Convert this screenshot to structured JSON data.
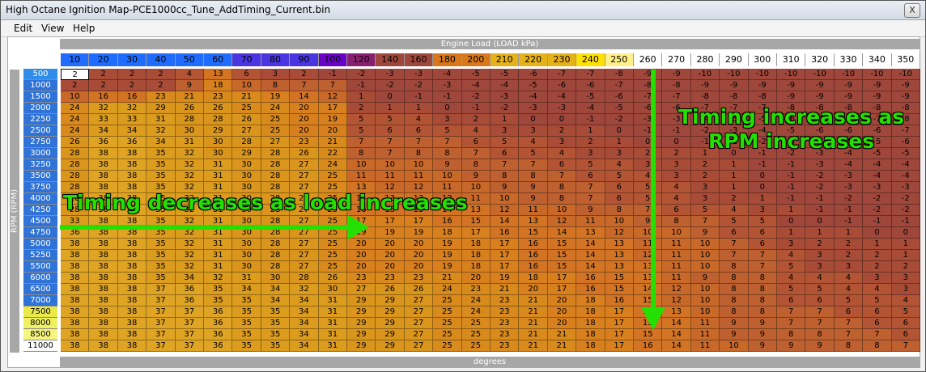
{
  "window": {
    "title": "High Octane Ignition Map-PCE1000cc_Tune_AddTiming_Current.bin",
    "close_label": "X"
  },
  "menu": [
    {
      "label": "Edit"
    },
    {
      "label": "View"
    },
    {
      "label": "Help"
    }
  ],
  "table": {
    "x_axis_title": "Engine Load (LOAD kPa)",
    "y_axis_title": "RPM (RPM)",
    "unit_label": "degrees",
    "load_headers": [
      10,
      20,
      30,
      40,
      50,
      60,
      70,
      80,
      90,
      100,
      120,
      140,
      160,
      180,
      200,
      210,
      220,
      230,
      240,
      250,
      260,
      270,
      280,
      290,
      300,
      310,
      320,
      330,
      340,
      350
    ],
    "rpm_headers": [
      500,
      1000,
      1500,
      2000,
      2250,
      2500,
      2750,
      3000,
      3250,
      3500,
      3750,
      4000,
      4250,
      4500,
      4750,
      5000,
      5250,
      5500,
      6000,
      6500,
      7000,
      7500,
      8000,
      8500,
      11000
    ],
    "values": [
      [
        2,
        2,
        2,
        2,
        4,
        13,
        6,
        3,
        2,
        -1,
        -2,
        -3,
        -3,
        -4,
        -5,
        -5,
        -6,
        -7,
        -7,
        -8,
        -9,
        -9,
        -10,
        -10,
        -10,
        -10,
        -10,
        -10,
        -10,
        -10
      ],
      [
        2,
        2,
        2,
        2,
        9,
        18,
        10,
        8,
        7,
        7,
        -1,
        -2,
        -2,
        -3,
        -4,
        -4,
        -5,
        -6,
        -6,
        -7,
        -8,
        -8,
        -9,
        -9,
        -9,
        -9,
        -9,
        -9,
        -9,
        -9
      ],
      [
        10,
        16,
        16,
        23,
        21,
        23,
        21,
        19,
        14,
        12,
        1,
        0,
        -1,
        -1,
        -2,
        -3,
        -4,
        -4,
        -5,
        -6,
        -7,
        -7,
        -8,
        -8,
        -8,
        -9,
        -9,
        -9,
        -9,
        -9
      ],
      [
        24,
        32,
        32,
        29,
        26,
        26,
        25,
        24,
        20,
        17,
        2,
        1,
        1,
        0,
        -1,
        -2,
        -3,
        -3,
        -4,
        -5,
        -6,
        -6,
        -7,
        -7,
        -7,
        -8,
        -8,
        -8,
        -8,
        -8
      ],
      [
        24,
        33,
        33,
        31,
        28,
        28,
        26,
        25,
        20,
        19,
        5,
        5,
        4,
        3,
        2,
        1,
        0,
        0,
        -1,
        -2,
        -3,
        -3,
        -4,
        -5,
        -5,
        -6,
        -7,
        -7,
        -7,
        -8
      ],
      [
        24,
        34,
        34,
        32,
        30,
        29,
        27,
        25,
        20,
        20,
        5,
        6,
        6,
        5,
        4,
        3,
        3,
        2,
        1,
        0,
        -1,
        -1,
        -2,
        -3,
        -4,
        -5,
        -6,
        -6,
        -6,
        -7
      ],
      [
        26,
        36,
        36,
        34,
        31,
        30,
        28,
        27,
        23,
        21,
        7,
        7,
        7,
        7,
        6,
        5,
        4,
        3,
        2,
        1,
        0,
        0,
        -1,
        -1,
        -2,
        -3,
        -4,
        -5,
        -5,
        -6
      ],
      [
        28,
        38,
        38,
        35,
        32,
        30,
        29,
        28,
        26,
        22,
        8,
        7,
        8,
        8,
        7,
        6,
        5,
        4,
        3,
        3,
        2,
        2,
        1,
        0,
        -1,
        -2,
        -3,
        -4,
        -5,
        -5
      ],
      [
        28,
        38,
        38,
        35,
        32,
        31,
        30,
        28,
        27,
        24,
        10,
        10,
        10,
        9,
        8,
        7,
        7,
        6,
        5,
        4,
        3,
        3,
        2,
        1,
        -1,
        -1,
        -3,
        -4,
        -4,
        -4
      ],
      [
        28,
        38,
        38,
        35,
        32,
        31,
        30,
        28,
        27,
        25,
        11,
        11,
        11,
        10,
        9,
        8,
        8,
        7,
        6,
        5,
        4,
        3,
        2,
        1,
        0,
        -1,
        -2,
        -3,
        -4,
        -4
      ],
      [
        28,
        38,
        38,
        35,
        32,
        31,
        30,
        28,
        27,
        25,
        13,
        12,
        12,
        11,
        10,
        9,
        9,
        8,
        7,
        6,
        5,
        4,
        3,
        1,
        0,
        -1,
        -2,
        -3,
        -3,
        -3
      ],
      [
        28,
        38,
        38,
        35,
        32,
        31,
        30,
        28,
        27,
        25,
        14,
        13,
        13,
        12,
        11,
        10,
        9,
        8,
        7,
        6,
        5,
        4,
        3,
        2,
        1,
        -1,
        -1,
        -2,
        -2,
        -2
      ],
      [
        28,
        38,
        38,
        35,
        32,
        31,
        30,
        28,
        27,
        25,
        16,
        15,
        15,
        14,
        13,
        12,
        11,
        10,
        9,
        8,
        7,
        6,
        5,
        4,
        3,
        1,
        -1,
        -1,
        -2,
        -2
      ],
      [
        33,
        38,
        38,
        35,
        32,
        31,
        30,
        28,
        27,
        25,
        17,
        17,
        17,
        16,
        15,
        14,
        13,
        12,
        11,
        10,
        9,
        8,
        7,
        5,
        5,
        0,
        0,
        -1,
        -1,
        -1
      ],
      [
        36,
        38,
        38,
        35,
        32,
        31,
        30,
        28,
        27,
        25,
        19,
        19,
        19,
        18,
        17,
        16,
        15,
        14,
        13,
        12,
        10,
        10,
        9,
        6,
        6,
        1,
        1,
        1,
        0,
        0
      ],
      [
        38,
        38,
        38,
        35,
        32,
        31,
        30,
        28,
        27,
        25,
        20,
        20,
        20,
        19,
        18,
        17,
        16,
        15,
        14,
        13,
        11,
        11,
        10,
        7,
        6,
        3,
        2,
        2,
        1,
        1
      ],
      [
        38,
        38,
        38,
        35,
        32,
        31,
        30,
        28,
        27,
        25,
        20,
        20,
        20,
        19,
        18,
        17,
        16,
        15,
        14,
        13,
        12,
        11,
        10,
        7,
        7,
        4,
        3,
        2,
        2,
        1
      ],
      [
        38,
        38,
        38,
        35,
        32,
        31,
        30,
        28,
        27,
        25,
        20,
        20,
        20,
        19,
        18,
        17,
        16,
        15,
        14,
        13,
        13,
        11,
        10,
        8,
        7,
        5,
        3,
        3,
        2,
        2
      ],
      [
        38,
        38,
        38,
        35,
        34,
        32,
        31,
        30,
        28,
        26,
        23,
        23,
        23,
        21,
        20,
        19,
        18,
        17,
        16,
        15,
        13,
        11,
        9,
        8,
        8,
        4,
        4,
        4,
        3,
        3
      ],
      [
        38,
        38,
        38,
        37,
        36,
        35,
        34,
        34,
        32,
        30,
        27,
        26,
        26,
        24,
        23,
        21,
        20,
        17,
        16,
        15,
        14,
        12,
        10,
        8,
        8,
        5,
        5,
        4,
        4,
        3
      ],
      [
        38,
        38,
        38,
        37,
        36,
        35,
        35,
        34,
        34,
        31,
        29,
        29,
        27,
        25,
        24,
        23,
        21,
        20,
        18,
        16,
        15,
        12,
        10,
        8,
        8,
        6,
        6,
        5,
        5,
        4
      ],
      [
        38,
        38,
        38,
        37,
        37,
        36,
        35,
        35,
        34,
        31,
        29,
        29,
        27,
        25,
        24,
        23,
        21,
        20,
        18,
        17,
        15,
        13,
        10,
        8,
        8,
        7,
        7,
        6,
        6,
        5
      ],
      [
        38,
        38,
        38,
        37,
        37,
        36,
        35,
        35,
        34,
        31,
        29,
        29,
        27,
        25,
        25,
        23,
        21,
        20,
        18,
        17,
        15,
        14,
        11,
        9,
        9,
        7,
        7,
        7,
        6,
        6
      ],
      [
        38,
        38,
        38,
        37,
        37,
        36,
        35,
        35,
        34,
        31,
        29,
        29,
        27,
        25,
        25,
        23,
        21,
        21,
        18,
        17,
        15,
        14,
        11,
        9,
        9,
        8,
        8,
        7,
        7,
        6
      ],
      [
        38,
        38,
        38,
        37,
        37,
        36,
        35,
        35,
        34,
        31,
        29,
        29,
        27,
        25,
        25,
        23,
        21,
        21,
        18,
        17,
        16,
        14,
        11,
        10,
        9,
        9,
        9,
        8,
        8,
        7
      ]
    ]
  },
  "annotations": {
    "load_text": "Timing decreases as load increases",
    "rpm_line1": "Timing increases as",
    "rpm_line2": "RPM increases",
    "arrow_color": "#23e000"
  },
  "colors": {
    "load_header_blues": "#1f6cff",
    "load_header_purple": "#6a00c8",
    "load_header_brown": "#8b2e2e",
    "load_header_yellow": "#ffe000",
    "rpm_header_blue": "#2f73d8",
    "cell_hot": "#a0473c",
    "cell_warm": "#d8781a",
    "cell_high": "#d9a020"
  }
}
